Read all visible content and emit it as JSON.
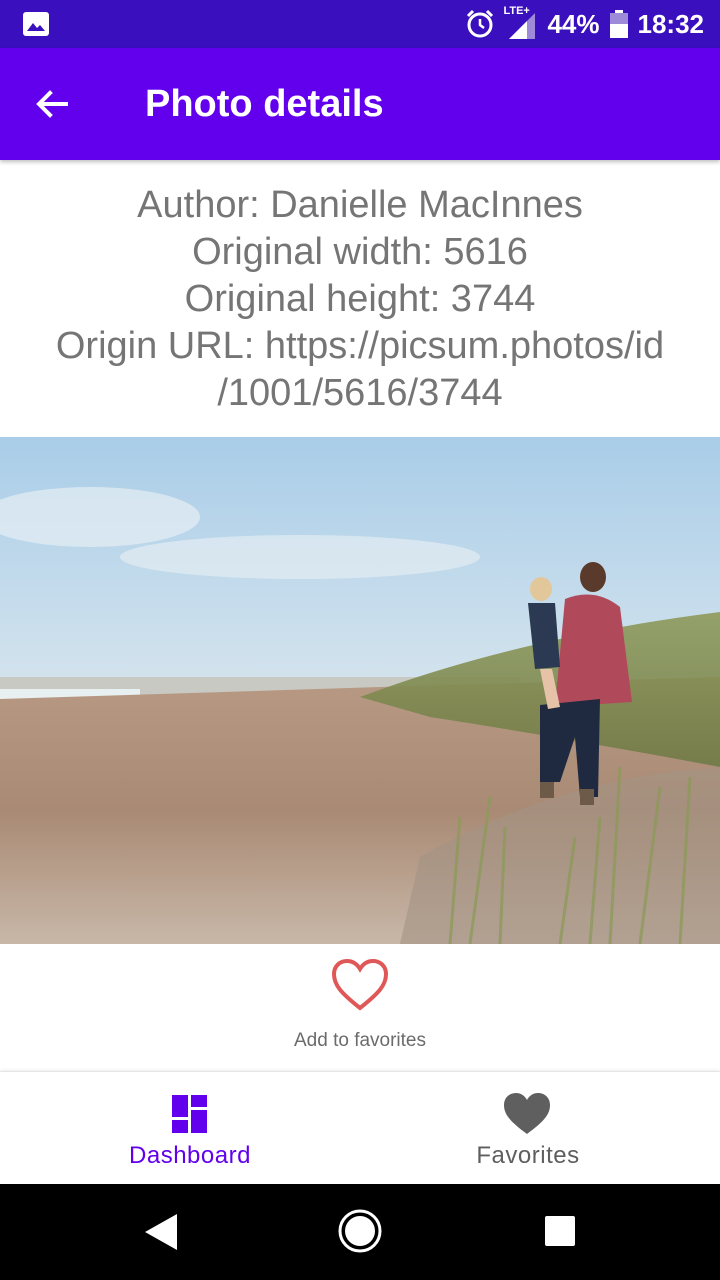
{
  "status_bar": {
    "network": "LTE+",
    "battery_percent": "44%",
    "time": "18:32",
    "icons": [
      "gallery-icon",
      "alarm-icon",
      "signal-icon",
      "battery-icon"
    ]
  },
  "app_bar": {
    "title": "Photo details",
    "back_icon": "arrow-back-icon"
  },
  "details": {
    "author": "Author: Danielle MacInnes",
    "width": "Original width: 5616",
    "height": "Original height: 3744",
    "url_line1": "Origin URL: https://picsum.photos/id",
    "url_line2": "/1001/5616/3744"
  },
  "favorite": {
    "label": "Add to favorites",
    "icon": "heart-outline-icon",
    "color": "#e05757"
  },
  "bottom_nav": {
    "items": [
      {
        "label": "Dashboard",
        "icon": "dashboard-icon",
        "active": true
      },
      {
        "label": "Favorites",
        "icon": "heart-icon",
        "active": false
      }
    ]
  },
  "colors": {
    "primary": "#6200ee",
    "status_bar": "#3a0fbe",
    "text_secondary": "#757575"
  }
}
